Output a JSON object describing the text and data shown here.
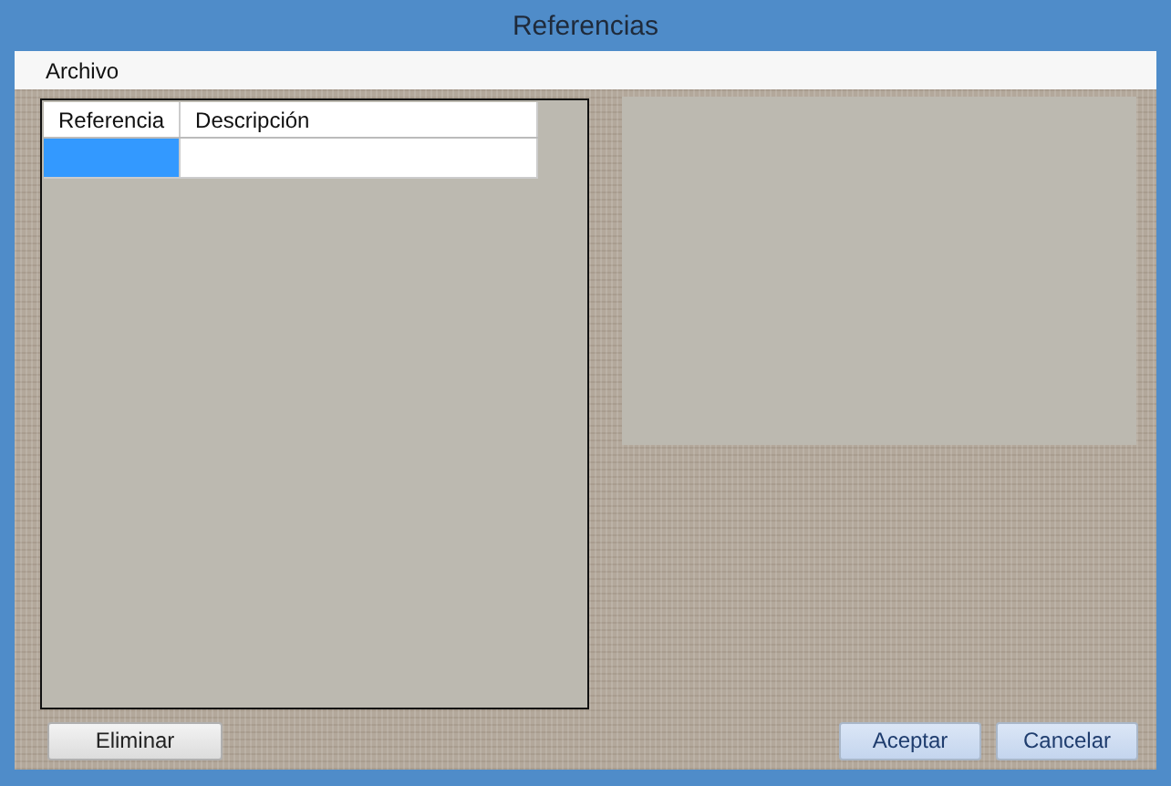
{
  "window": {
    "title": "Referencias"
  },
  "menu": [
    {
      "label": "Archivo"
    }
  ],
  "table": {
    "columns": [
      "Referencia",
      "Descripción"
    ],
    "rows": [
      {
        "cells": [
          "",
          ""
        ],
        "selected": true
      }
    ]
  },
  "buttons": [
    {
      "label": "Eliminar",
      "kind": "plain"
    },
    {
      "label": "Aceptar",
      "kind": "accent"
    },
    {
      "label": "Cancelar",
      "kind": "accent"
    }
  ]
}
